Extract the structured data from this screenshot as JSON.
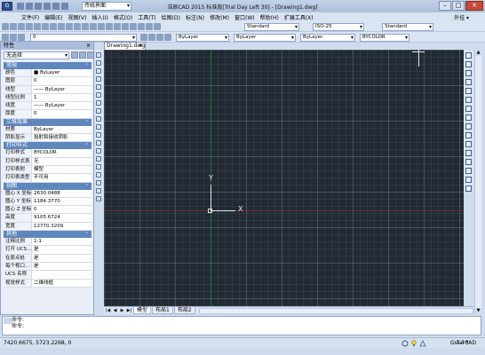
{
  "window": {
    "title": "浩辰CAD 2015 标准版[Trial Day Left 30] - [Drawing1.dwg]",
    "workspace": "传统界面",
    "search_label": "外挂 ▾"
  },
  "menu": [
    "文件(F)",
    "编辑(E)",
    "视图(V)",
    "插入(I)",
    "格式(O)",
    "工具(T)",
    "绘图(D)",
    "标注(N)",
    "修改(M)",
    "窗口(W)",
    "帮助(H)",
    "扩展工具(X)"
  ],
  "toolbar1": {
    "text_style": "Standard",
    "dim_style": "ISO-25",
    "table_style": "Standard"
  },
  "toolbar2": {
    "layer": "0",
    "color": "ByLayer",
    "linetype": "ByLayer",
    "lineweight": "ByLayer",
    "plotstyle": "BYCOLOR"
  },
  "properties": {
    "title": "特性",
    "selection": "无选择",
    "sections": [
      {
        "name": "常规",
        "rows": [
          {
            "k": "颜色",
            "v": "■ ByLayer"
          },
          {
            "k": "图层",
            "v": "0"
          },
          {
            "k": "线型",
            "v": "—— ByLayer"
          },
          {
            "k": "线型比例",
            "v": "1"
          },
          {
            "k": "线宽",
            "v": "—— ByLayer"
          },
          {
            "k": "厚度",
            "v": "0"
          }
        ]
      },
      {
        "name": "三维效果",
        "rows": [
          {
            "k": "材质",
            "v": "ByLayer"
          },
          {
            "k": "阴影显示",
            "v": "投射和接收阴影"
          }
        ]
      },
      {
        "name": "打印样式",
        "rows": [
          {
            "k": "打印样式",
            "v": "BYCOLOR"
          },
          {
            "k": "打印样式表",
            "v": "无"
          },
          {
            "k": "打印表附",
            "v": "模型"
          },
          {
            "k": "打印表类型",
            "v": "不可用"
          }
        ]
      },
      {
        "name": "视图",
        "rows": [
          {
            "k": "圆心 X 坐标",
            "v": "2630.0488"
          },
          {
            "k": "圆心 Y 坐标",
            "v": "1184.3770"
          },
          {
            "k": "圆心 Z 坐标",
            "v": "0"
          },
          {
            "k": "高度",
            "v": "9105.6724"
          },
          {
            "k": "宽度",
            "v": "12770.3209"
          }
        ]
      },
      {
        "name": "其他",
        "rows": [
          {
            "k": "注释比例",
            "v": "1:1"
          },
          {
            "k": "打开 UCS...",
            "v": "是"
          },
          {
            "k": "在原点处",
            "v": "是"
          },
          {
            "k": "每个视口...",
            "v": "是"
          },
          {
            "k": "UCS 名称",
            "v": ""
          },
          {
            "k": "视觉样式",
            "v": "二维线框"
          }
        ]
      }
    ]
  },
  "document": {
    "tab": "Drawing1.dwg",
    "axis_y": "Y",
    "axis_x": "X"
  },
  "layouts": [
    "模型",
    "布局1",
    "布局2"
  ],
  "command": {
    "line1": "命令:",
    "line2": "命令:"
  },
  "status": {
    "coords": "7420.6675, 5723.2268, 0",
    "scale": "1:1 ▾",
    "brand": "GstarCAD"
  }
}
